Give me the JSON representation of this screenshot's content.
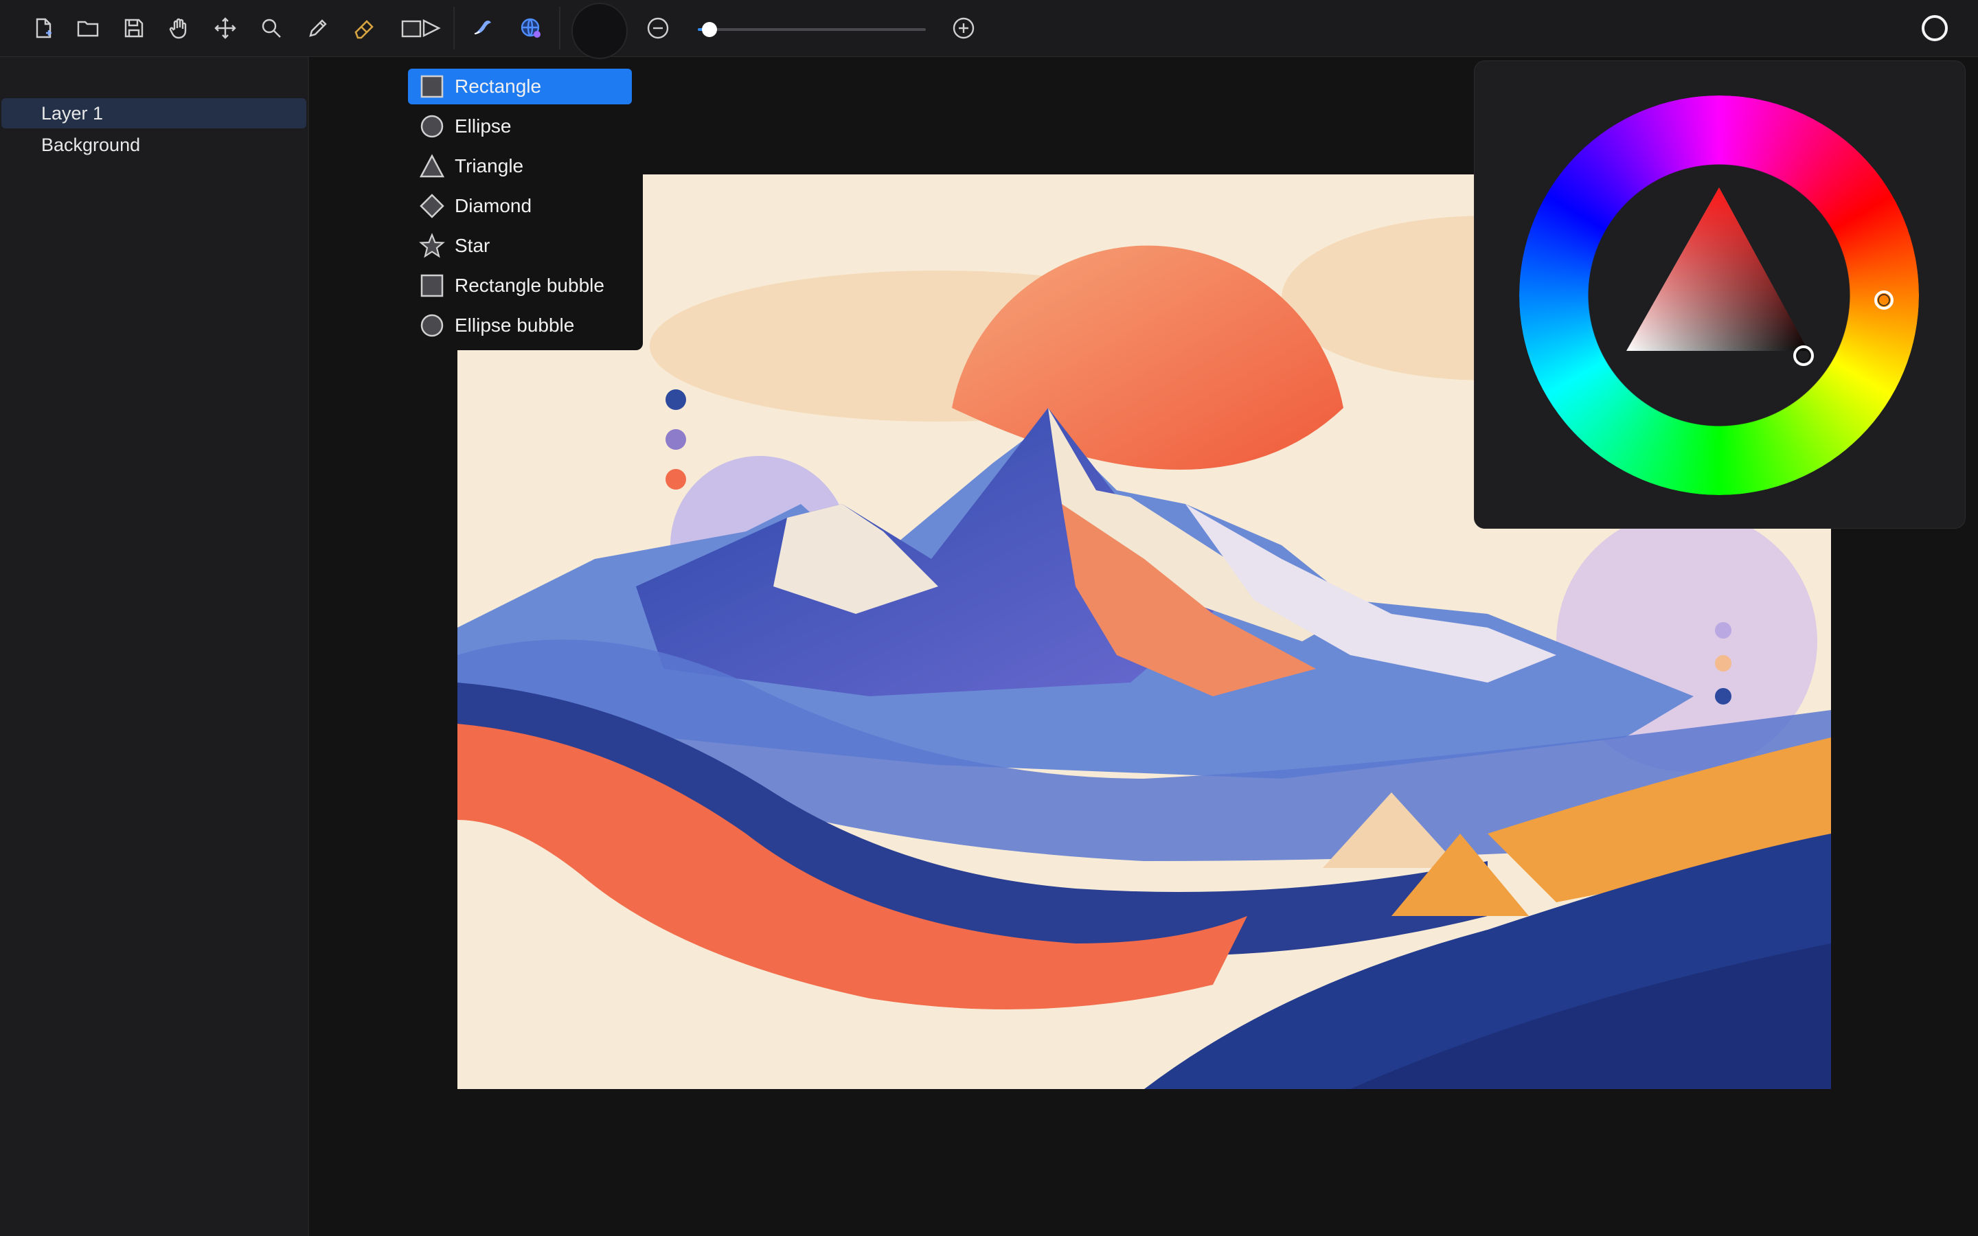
{
  "toolbar": {
    "tools": [
      {
        "name": "new-file-icon",
        "label": "New"
      },
      {
        "name": "open-folder-icon",
        "label": "Open"
      },
      {
        "name": "save-icon",
        "label": "Save"
      },
      {
        "name": "hand-icon",
        "label": "Pan"
      },
      {
        "name": "move-icon",
        "label": "Move"
      },
      {
        "name": "zoom-icon",
        "label": "Zoom"
      },
      {
        "name": "pencil-icon",
        "label": "Pencil"
      },
      {
        "name": "eraser-icon",
        "label": "Eraser"
      },
      {
        "name": "shape-tool-icon",
        "label": "Shapes"
      },
      {
        "name": "smudge-icon",
        "label": "Smudge"
      },
      {
        "name": "fill-globe-icon",
        "label": "Fill"
      }
    ],
    "zoom_level": 0.05,
    "accent_color": "#2f8cff"
  },
  "layers": {
    "items": [
      {
        "label": "Layer 1",
        "selected": true
      },
      {
        "label": "Background",
        "selected": false
      }
    ]
  },
  "shape_menu": {
    "items": [
      {
        "label": "Rectangle",
        "icon": "rectangle-icon",
        "selected": true
      },
      {
        "label": "Ellipse",
        "icon": "ellipse-icon",
        "selected": false
      },
      {
        "label": "Triangle",
        "icon": "triangle-icon",
        "selected": false
      },
      {
        "label": "Diamond",
        "icon": "diamond-icon",
        "selected": false
      },
      {
        "label": "Star",
        "icon": "star-icon",
        "selected": false
      },
      {
        "label": "Rectangle bubble",
        "icon": "rectangle-bubble-icon",
        "selected": false
      },
      {
        "label": "Ellipse bubble",
        "icon": "ellipse-bubble-icon",
        "selected": false
      }
    ],
    "selected_color": "#1f7bf2"
  },
  "color_picker": {
    "hue_marker_color": "#ff0000",
    "selected_color": "#1a1a1a"
  },
  "canvas": {
    "artwork": "abstract-mountain-painting",
    "palette": [
      "#f6ead6",
      "#f26b4a",
      "#2d4a9e",
      "#8c7cc9",
      "#f4a03a",
      "#c9c1e6"
    ]
  }
}
